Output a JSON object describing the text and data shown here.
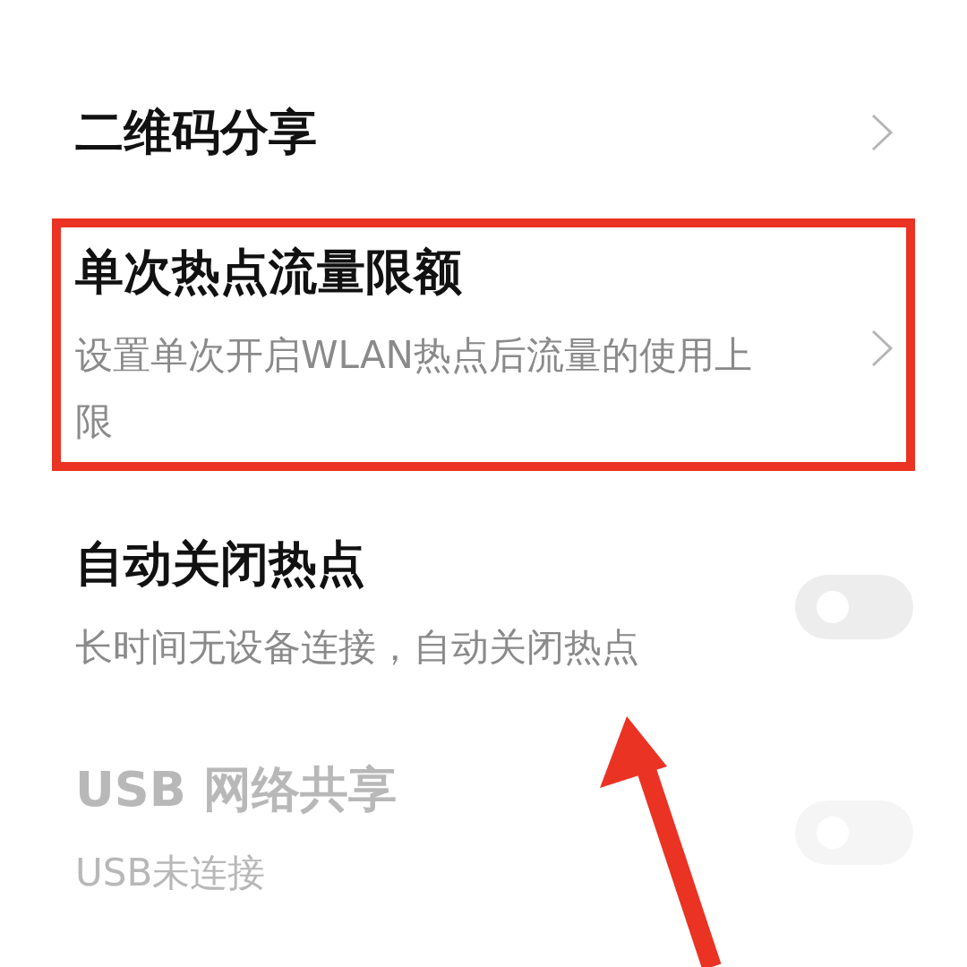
{
  "settings": [
    {
      "kind": "link",
      "title": "二维码分享",
      "highlighted": false,
      "disabled": false
    },
    {
      "kind": "link",
      "title": "单次热点流量限额",
      "subtitle": "设置单次开启WLAN热点后流量的使用上限",
      "highlighted": true,
      "disabled": false
    },
    {
      "kind": "toggle",
      "title": "自动关闭热点",
      "subtitle": "长时间无设备连接，自动关闭热点",
      "on": false,
      "highlighted": false,
      "disabled": false
    },
    {
      "kind": "toggle",
      "title": "USB 网络共享",
      "subtitle": "USB未连接",
      "on": false,
      "highlighted": false,
      "disabled": true
    }
  ]
}
